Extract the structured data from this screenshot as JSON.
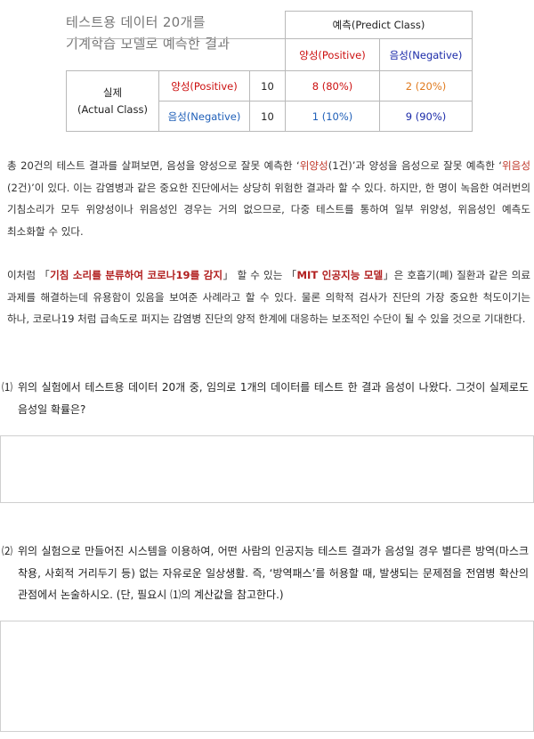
{
  "caption": {
    "line1": "테스트용 데이터 20개를",
    "line2": "기계학습 모델로 예측한 결과"
  },
  "matrix": {
    "predict_header": "예측(Predict Class)",
    "predict_pos": "양성(Positive)",
    "predict_neg": "음성(Negative)",
    "actual_line1": "실제",
    "actual_line2": "(Actual Class)",
    "rows": [
      {
        "label": "양성(Positive)",
        "total": "10",
        "tp": "8 (80%)",
        "fn": "2 (20%)"
      },
      {
        "label": "음성(Negative)",
        "total": "10",
        "fp": "1 (10%)",
        "tn": "9 (90%)"
      }
    ]
  },
  "para1": {
    "t1": "총 20건의 테스트 결과를 살펴보면, 음성을 양성으로 잘못 예측한 ‘",
    "h1": "위양성",
    "t2": "(1건)’과 양성을 음성으로 잘못 예측한 ‘",
    "h2": "위음성",
    "t3": "(2건)’이 있다. 이는 감염병과 같은 중요한 진단에서는 상당히 위험한 결과라 할 수 있다. 하지만, 한 명이 녹음한 여러번의 기침소리가 모두 위양성이나 위음성인 경우는 거의 없으므로, 다중 테스트를 통하여 일부 위양성, 위음성인 예측도 최소화할 수 있다."
  },
  "para2": {
    "t1": "이처럼 「",
    "h1": "기침 소리를 분류하여 코로나19를 감지",
    "t2": "」 할 수 있는 「",
    "h2": "MIT 인공지능 모델",
    "t3": "」은 호흡기(폐) 질환과 같은 의료 과제를 해결하는데 유용함이 있음을 보여준 사례라고 할 수 있다. 물론 의학적 검사가 진단의 가장 중요한 척도이기는 하나, 코로나19 처럼 급속도로 퍼지는 감염병 진단의 양적 한계에 대응하는 보조적인 수단이 될 수 있을 것으로 기대한다."
  },
  "q1": {
    "num": "⑴",
    "text": "위의 실험에서 테스트용 데이터 20개 중, 임의로 1개의 데이터를 테스트 한 결과 음성이 나왔다. 그것이 실제로도 음성일 확률은?"
  },
  "q2": {
    "num": "⑵",
    "text": "위의 실험으로 만들어진 시스템을 이용하여, 어떤 사람의 인공지능 테스트 결과가 음성일 경우 별다른 방역(마스크 착용, 사회적 거리두기 등) 없는 자유로운 일상생활. 즉, ‘방역패스’를 허용할 때, 발생되는 문제점을 전염병 확산의 관점에서 논술하시오. (단, 필요시 ⑴의 계산값을 참고한다.)"
  },
  "answer_boxes": [
    {},
    {}
  ]
}
